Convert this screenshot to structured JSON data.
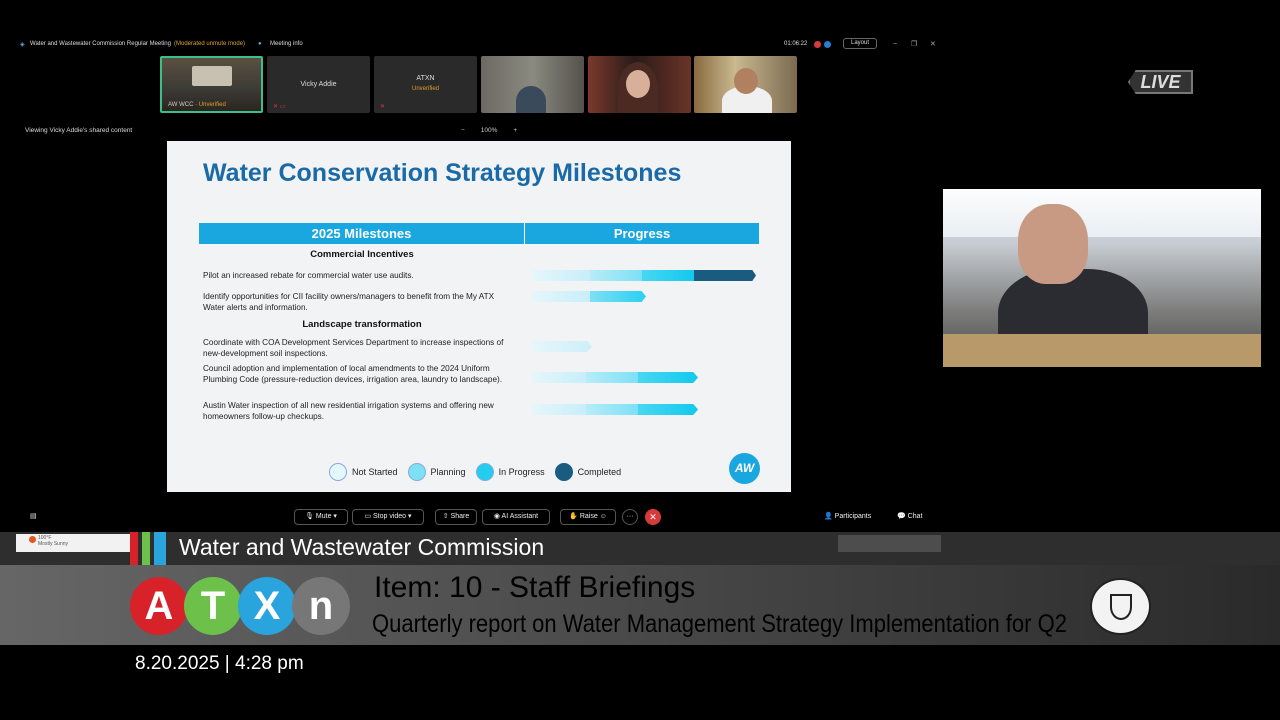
{
  "topbar": {
    "meeting_title": "Water and Wastewater Commission Regular Meeting",
    "mode": "(Moderated unmute mode)",
    "meeting_info": "Meeting info",
    "timer": "01:06:22",
    "layout": "Layout"
  },
  "tiles": [
    {
      "name": "AW WCC",
      "status": "Unverified"
    },
    {
      "name": "Vicky Addie",
      "status": ""
    },
    {
      "name": "ATXN",
      "status": "Unverified"
    },
    {
      "name": "",
      "status": ""
    },
    {
      "name": "",
      "status": ""
    },
    {
      "name": "",
      "status": ""
    }
  ],
  "live_badge": "LIVE",
  "viewing": "Viewing Vicky Addie's shared content",
  "zoom": {
    "minus": "−",
    "value": "100%",
    "plus": "+"
  },
  "slide": {
    "title": "Water Conservation Strategy Milestones",
    "col_milestones": "2025 Milestones",
    "col_progress": "Progress",
    "sections": [
      {
        "title": "Commercial Incentives",
        "rows": [
          {
            "text": "Pilot an increased rebate for commercial water use audits.",
            "stage": "Completed"
          },
          {
            "text": "Identify opportunities for CII facility owners/managers to benefit from the My ATX Water alerts and information.",
            "stage": "In Progress"
          }
        ]
      },
      {
        "title": "Landscape transformation",
        "rows": [
          {
            "text": "Coordinate with COA Development Services Department to increase inspections of new-development soil inspections.",
            "stage": "Not Started"
          },
          {
            "text": "Council adoption and implementation of local amendments to the 2024 Uniform Plumbing Code (pressure-reduction devices, irrigation area, laundry to landscape).",
            "stage": "In Progress"
          },
          {
            "text": "Austin Water inspection of all new residential irrigation systems and offering new homeowners follow-up checkups.",
            "stage": "In Progress"
          }
        ]
      }
    ],
    "legend": [
      "Not Started",
      "Planning",
      "In Progress",
      "Completed"
    ],
    "logo_text": "AW"
  },
  "controls": {
    "mute": "Mute",
    "stop_video": "Stop video",
    "share": "Share",
    "ai_assistant": "AI Assistant",
    "raise": "Raise",
    "participants": "Participants",
    "chat": "Chat"
  },
  "weather": {
    "temp": "100°F",
    "condition": "Mostly Sunny"
  },
  "lower_third": {
    "commission": "Water and Wastewater Commission",
    "atxn_letters": [
      "A",
      "T",
      "X",
      "n"
    ],
    "item": "Item: 10 - Staff Briefings",
    "subtitle": "Quarterly report on Water Management Strategy Implementation for Q2",
    "datetime": "8.20.2025 | 4:28 pm"
  },
  "colors": {
    "slide_title": "#1a6aa8",
    "table_header": "#1aa7e0",
    "completed": "#1a5b80",
    "in_progress": "#12c9ee",
    "planning": "#7de0f5",
    "not_started": "#d6f3fa"
  }
}
